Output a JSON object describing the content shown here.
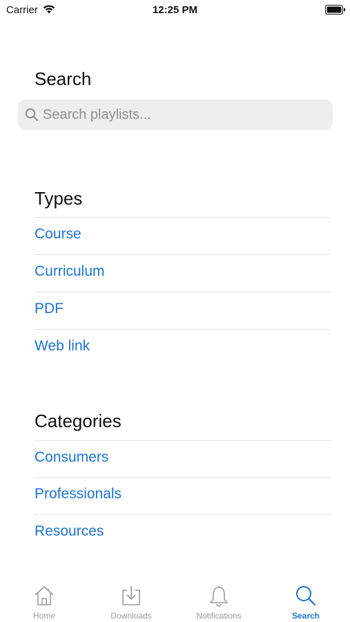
{
  "status_bar": {
    "carrier": "Carrier",
    "time": "12:25 PM"
  },
  "search": {
    "title": "Search",
    "placeholder": "Search playlists...",
    "value": ""
  },
  "types": {
    "title": "Types",
    "items": [
      "Course",
      "Curriculum",
      "PDF",
      "Web link"
    ]
  },
  "categories": {
    "title": "Categories",
    "items": [
      "Consumers",
      "Professionals",
      "Resources"
    ]
  },
  "tab_bar": {
    "tabs": [
      {
        "label": "Home",
        "icon": "home-icon"
      },
      {
        "label": "Downloads",
        "icon": "download-icon"
      },
      {
        "label": "Notifications",
        "icon": "bell-icon"
      },
      {
        "label": "Search",
        "icon": "search-icon"
      }
    ],
    "active": "Search"
  },
  "colors": {
    "accent": "#1c74d0",
    "inactive_tab": "#9a9a9f",
    "search_field_bg": "#eeeeef"
  }
}
